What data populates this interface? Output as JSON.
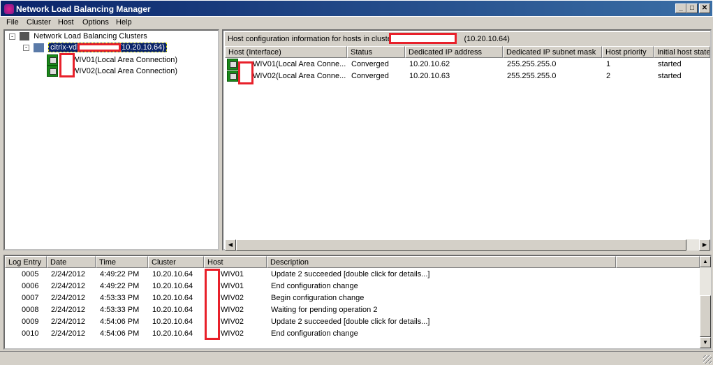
{
  "window": {
    "title": "Network Load Balancing Manager"
  },
  "menu": [
    "File",
    "Cluster",
    "Host",
    "Options",
    "Help"
  ],
  "tree": {
    "root": "Network Load Balancing Clusters",
    "cluster_prefix": "citrix-vdi",
    "cluster_ip": "(10.20.10.64)",
    "hosts": [
      "WIV01(Local Area Connection)",
      "WIV02(Local Area Connection)"
    ]
  },
  "hosts_panel": {
    "caption_prefix": "Host configuration information for hosts in cluster",
    "caption_ip": "(10.20.10.64)",
    "columns": [
      "Host (Interface)",
      "Status",
      "Dedicated IP address",
      "Dedicated IP subnet mask",
      "Host priority",
      "Initial host state"
    ],
    "rows": [
      [
        "WIV01(Local Area Conne...",
        "Converged",
        "10.20.10.62",
        "255.255.255.0",
        "1",
        "started"
      ],
      [
        "WIV02(Local Area Conne...",
        "Converged",
        "10.20.10.63",
        "255.255.255.0",
        "2",
        "started"
      ]
    ]
  },
  "log": {
    "columns": [
      "Log Entry",
      "Date",
      "Time",
      "Cluster",
      "Host",
      "Description"
    ],
    "rows": [
      [
        "0005",
        "2/24/2012",
        "4:49:22 PM",
        "10.20.10.64",
        "WIV01",
        "Update 2 succeeded [double click for details...]"
      ],
      [
        "0006",
        "2/24/2012",
        "4:49:22 PM",
        "10.20.10.64",
        "WIV01",
        "End configuration change"
      ],
      [
        "0007",
        "2/24/2012",
        "4:53:33 PM",
        "10.20.10.64",
        "WIV02",
        "Begin configuration change"
      ],
      [
        "0008",
        "2/24/2012",
        "4:53:33 PM",
        "10.20.10.64",
        "WIV02",
        "Waiting for pending operation 2"
      ],
      [
        "0009",
        "2/24/2012",
        "4:54:06 PM",
        "10.20.10.64",
        "WIV02",
        "Update 2 succeeded [double click for details...]"
      ],
      [
        "0010",
        "2/24/2012",
        "4:54:06 PM",
        "10.20.10.64",
        "WIV02",
        "End configuration change"
      ]
    ]
  },
  "colors": {
    "titlebar": "#0a246a",
    "redaction": "#e8202a",
    "selection": "#0a246a"
  }
}
